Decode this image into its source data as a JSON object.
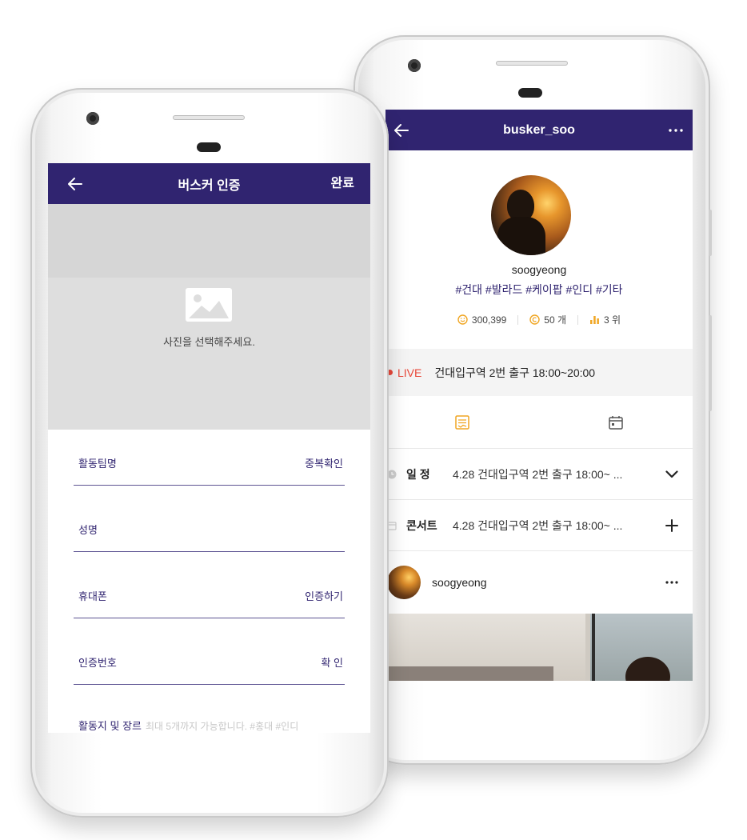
{
  "left_screen": {
    "header": {
      "title": "버스커 인증",
      "done_label": "완료"
    },
    "photo": {
      "hint": "사진을 선택해주세요."
    },
    "form": {
      "rows": [
        {
          "label": "활동팀명",
          "action": "중복확인"
        },
        {
          "label": "성명",
          "action": ""
        },
        {
          "label": "휴대폰",
          "action": "인증하기"
        },
        {
          "label": "인증번호",
          "action": "확 인"
        }
      ],
      "partial": {
        "label": "활동지 및 장르",
        "placeholder": "최대 5개까지 가능합니다. #홍대 #인디"
      }
    }
  },
  "right_screen": {
    "header": {
      "title": "busker_soo"
    },
    "profile": {
      "username": "soogyeong",
      "tags": "#건대 #발라드 #케이팝 #인디 #기타",
      "stats": {
        "fans": "300,399",
        "coins": "50 개",
        "rank": "3 위"
      }
    },
    "live": {
      "label": "LIVE",
      "text": "건대입구역 2번 출구 18:00~20:00"
    },
    "schedule": {
      "label": "일 정",
      "text": "4.28 건대입구역 2번 출구 18:00~ ..."
    },
    "concert": {
      "label": "콘서트",
      "text": "4.28 건대입구역 2번 출구 18:00~ ..."
    },
    "post": {
      "author": "soogyeong"
    }
  },
  "colors": {
    "primary": "#302470",
    "accent": "#f0a623",
    "live": "#e8483a"
  }
}
